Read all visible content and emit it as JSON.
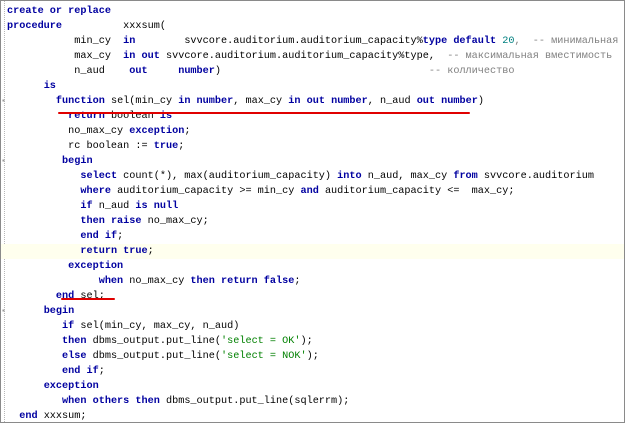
{
  "editor": {
    "lines": [
      [
        [
          "create or replace",
          "kw"
        ]
      ],
      [
        [
          "procedure",
          "kw"
        ],
        [
          "          xxxsum(",
          "plain"
        ]
      ],
      [
        [
          "           min_cy  ",
          "plain"
        ],
        [
          "in",
          "kw"
        ],
        [
          "        svvcore.auditorium.auditorium_capacity%",
          "plain"
        ],
        [
          "type default ",
          "kw"
        ],
        [
          "20",
          "num"
        ],
        [
          ",  -- минимальная в",
          "cmt"
        ]
      ],
      [
        [
          "           max_cy  ",
          "plain"
        ],
        [
          "in out",
          "kw"
        ],
        [
          " svvcore.auditorium.auditorium_capacity%type,  ",
          "plain"
        ],
        [
          "-- максимальная вместимость",
          "cmt"
        ]
      ],
      [
        [
          "           n_aud    ",
          "plain"
        ],
        [
          "out",
          "kw"
        ],
        [
          "     ",
          "plain"
        ],
        [
          "number",
          "kw"
        ],
        [
          ")                                  ",
          "plain"
        ],
        [
          "-- колличество",
          "cmt"
        ]
      ],
      [
        [
          "      ",
          "plain"
        ],
        [
          "is",
          "kw"
        ]
      ],
      [
        [
          "        ",
          "plain"
        ],
        [
          "function",
          "kw"
        ],
        [
          " sel(min_cy ",
          "plain"
        ],
        [
          "in number",
          "kw"
        ],
        [
          ", max_cy ",
          "plain"
        ],
        [
          "in out number",
          "kw"
        ],
        [
          ", n_aud ",
          "plain"
        ],
        [
          "out number",
          "kw"
        ],
        [
          ")",
          "plain"
        ]
      ],
      [
        [
          "          ",
          "plain"
        ],
        [
          "return",
          "kw"
        ],
        [
          " boolean ",
          "plain"
        ],
        [
          "is",
          "kw"
        ]
      ],
      [
        [
          "          no_max_cy ",
          "plain"
        ],
        [
          "exception",
          "kw"
        ],
        [
          ";",
          "plain"
        ]
      ],
      [
        [
          "          rc boolean := ",
          "plain"
        ],
        [
          "true",
          "kw"
        ],
        [
          ";",
          "plain"
        ]
      ],
      [
        [
          "         ",
          "plain"
        ],
        [
          "begin",
          "kw"
        ]
      ],
      [
        [
          "            ",
          "plain"
        ],
        [
          "select",
          "kw"
        ],
        [
          " count(*), max(auditorium_capacity) ",
          "plain"
        ],
        [
          "into",
          "kw"
        ],
        [
          " n_aud, max_cy ",
          "plain"
        ],
        [
          "from",
          "kw"
        ],
        [
          " svvcore.auditorium",
          "plain"
        ]
      ],
      [
        [
          "            ",
          "plain"
        ],
        [
          "where",
          "kw"
        ],
        [
          " auditorium_capacity >= min_cy ",
          "plain"
        ],
        [
          "and",
          "kw"
        ],
        [
          " auditorium_capacity <=  max_cy;",
          "plain"
        ]
      ],
      [
        [
          "            ",
          "plain"
        ],
        [
          "if",
          "kw"
        ],
        [
          " n_aud ",
          "plain"
        ],
        [
          "is null",
          "kw"
        ]
      ],
      [
        [
          "            ",
          "plain"
        ],
        [
          "then raise",
          "kw"
        ],
        [
          " no_max_cy;",
          "plain"
        ]
      ],
      [
        [
          "            ",
          "plain"
        ],
        [
          "end if",
          "kw"
        ],
        [
          ";",
          "plain"
        ]
      ],
      [
        [
          "            ",
          "plain"
        ],
        [
          "return true",
          "kw"
        ],
        [
          ";",
          "plain"
        ]
      ],
      [
        [
          "          ",
          "plain"
        ],
        [
          "exception",
          "kw"
        ]
      ],
      [
        [
          "               ",
          "plain"
        ],
        [
          "when",
          "kw"
        ],
        [
          " no_max_cy ",
          "plain"
        ],
        [
          "then return false",
          "kw"
        ],
        [
          ";",
          "plain"
        ]
      ],
      [
        [
          "        ",
          "plain"
        ],
        [
          "end",
          "kw"
        ],
        [
          " sel;",
          "plain"
        ]
      ],
      [
        [
          "      ",
          "plain"
        ],
        [
          "begin",
          "kw"
        ]
      ],
      [
        [
          "         ",
          "plain"
        ],
        [
          "if",
          "kw"
        ],
        [
          " sel(min_cy, max_cy, n_aud)",
          "plain"
        ]
      ],
      [
        [
          "         ",
          "plain"
        ],
        [
          "then",
          "kw"
        ],
        [
          " dbms_output.put_line(",
          "plain"
        ],
        [
          "'select = OK'",
          "str"
        ],
        [
          ");",
          "plain"
        ]
      ],
      [
        [
          "         ",
          "plain"
        ],
        [
          "else",
          "kw"
        ],
        [
          " dbms_output.put_line(",
          "plain"
        ],
        [
          "'select = NOK'",
          "str"
        ],
        [
          ");",
          "plain"
        ]
      ],
      [
        [
          "         ",
          "plain"
        ],
        [
          "end if",
          "kw"
        ],
        [
          ";",
          "plain"
        ]
      ],
      [
        [
          "      ",
          "plain"
        ],
        [
          "exception",
          "kw"
        ]
      ],
      [
        [
          "         ",
          "plain"
        ],
        [
          "when others then",
          "kw"
        ],
        [
          " dbms_output.put_line(sqlerrm);",
          "plain"
        ]
      ],
      [
        [
          "  ",
          "plain"
        ],
        [
          "end",
          "kw"
        ],
        [
          " xxxsum;",
          "plain"
        ]
      ]
    ],
    "highlighted_line_index": 16,
    "colors": {
      "keyword": "#0000a0",
      "comment": "#808080",
      "number": "#008080",
      "string": "#008000",
      "underline": "#e00000",
      "current_line": "#ffffee"
    }
  }
}
